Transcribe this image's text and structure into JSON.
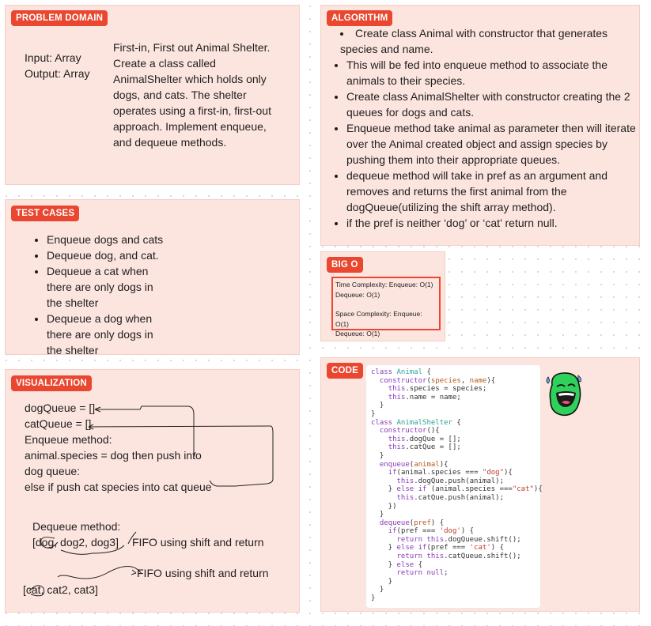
{
  "problem_domain": {
    "tag": "PROBLEM DOMAIN",
    "input_label": "Input: Array",
    "output_label": "Output: Array",
    "description": "First-in, First out Animal Shelter. Create a class called AnimalShelter which holds only dogs, and cats. The shelter operates using a first-in, first-out approach. Implement enqueue, and dequeue methods."
  },
  "test_cases": {
    "tag": "TEST CASES",
    "items": [
      "Enqueue dogs and cats",
      "Dequeue dog, and cat.",
      "Dequeue a cat when there are only dogs in the shelter",
      "Dequeue a dog when there are only dogs in the shelter"
    ]
  },
  "visualization": {
    "tag": "VISUALIZATION",
    "lines": [
      "dogQueue = []",
      "catQueue = []",
      "Enqueue method:",
      "animal.species = dog then push into",
      "dog queue:",
      "else if push cat species into cat queue"
    ],
    "dequeue_title": "Dequeue method:",
    "dog_array": "[dog, dog2, dog3]",
    "dog_note": "FIFO using shift and return",
    "cat_note": "FIFO using shift and return",
    "cat_array": "[cat, cat2, cat3]"
  },
  "algorithm": {
    "tag": "ALGORITHM",
    "items": [
      "Create class Animal with constructor that generates species and name.",
      "This will be fed into enqueue method to associate the animals to their species.",
      "Create class AnimalShelter with constructor creating the 2 queues for dogs and cats.",
      "Enqueue method take animal as parameter then will iterate over the Animal created object and assign species by pushing them into their appropriate queues.",
      "dequeue method will take in pref as an argument and removes and returns the first animal from the dogQueue(utilizing the shift array method).",
      "if the pref is neither ‘dog’ or ‘cat’ return null."
    ]
  },
  "big_o": {
    "tag": "BIG O",
    "time_line1": "Time Complexity: Enqueue: O(1)",
    "time_line2": "Dequeue: O(1)",
    "space_line1": "Space Complexity: Enqueue: O(1)",
    "space_line2": "Dequeue: O(1)"
  },
  "code": {
    "tag": "CODE",
    "sticker": "laughing-face-sticker"
  },
  "colors": {
    "card_bg": "#fde5df",
    "tag_bg": "#e9472f",
    "sticker_green": "#2fd15a"
  }
}
